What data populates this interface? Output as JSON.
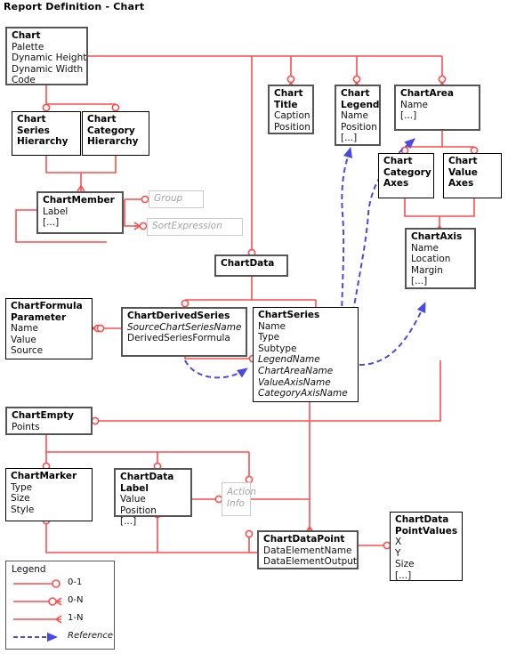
{
  "page": {
    "title": "Report Definition - Chart"
  },
  "colors": {
    "relationship": "#ff4d4d",
    "reference": "#4a4ae0",
    "box_border": "#000000",
    "box_border_thick": "#555555",
    "ghost_border": "#cccccc",
    "ghost_text": "#a6a6a6",
    "background": "#ffffff",
    "text": "#111111"
  },
  "entities": [
    {
      "id": "chart",
      "title": "Chart",
      "attributes": [
        "Palette",
        "Dynamic Height",
        "Dynamic Width",
        "Code"
      ],
      "style": "thick"
    },
    {
      "id": "chart-series-hierarchy",
      "title": "Chart Series Hierarchy",
      "title_lines": [
        "Chart",
        "Series",
        "Hierarchy"
      ],
      "attributes": [],
      "style": "normal"
    },
    {
      "id": "chart-category-hierarchy",
      "title": "Chart Category Hierarchy",
      "title_lines": [
        "Chart",
        "Category",
        "Hierarchy"
      ],
      "attributes": [],
      "style": "normal"
    },
    {
      "id": "chart-member",
      "title": "ChartMember",
      "attributes": [
        "Label",
        "[...]"
      ],
      "style": "thick"
    },
    {
      "id": "chart-title",
      "title": "Chart Title",
      "title_lines": [
        "Chart",
        "Title"
      ],
      "attributes": [
        "Caption",
        "Position"
      ],
      "style": "thick"
    },
    {
      "id": "chart-legend",
      "title": "Chart Legend",
      "title_lines": [
        "Chart",
        "Legend"
      ],
      "attributes": [
        "Name",
        "Position",
        "[...]"
      ],
      "style": "thick"
    },
    {
      "id": "chart-area",
      "title": "ChartArea",
      "attributes": [
        "Name",
        "[...]"
      ],
      "style": "thick"
    },
    {
      "id": "chart-category-axes",
      "title": "Chart Category Axes",
      "title_lines": [
        "Chart",
        "Category",
        "Axes"
      ],
      "attributes": [],
      "style": "normal"
    },
    {
      "id": "chart-value-axes",
      "title": "Chart Value Axes",
      "title_lines": [
        "Chart",
        "Value",
        "Axes"
      ],
      "attributes": [],
      "style": "normal"
    },
    {
      "id": "chart-axis",
      "title": "ChartAxis",
      "attributes": [
        "Name",
        "Location",
        "Margin",
        "[...]"
      ],
      "style": "thick"
    },
    {
      "id": "chart-data",
      "title": "ChartData",
      "attributes": [],
      "style": "thick"
    },
    {
      "id": "chart-formula-parameter",
      "title": "ChartFormula Parameter",
      "title_lines": [
        "ChartFormula",
        "Parameter"
      ],
      "attributes": [
        "Name",
        "Value",
        "Source"
      ],
      "style": "normal"
    },
    {
      "id": "chart-derived-series",
      "title": "ChartDerivedSeries",
      "attributes": [
        "SourceChartSeriesName",
        "DerivedSeriesFormula"
      ],
      "italic_attributes": [
        "SourceChartSeriesName"
      ],
      "style": "thick"
    },
    {
      "id": "chart-series",
      "title": "ChartSeries",
      "attributes": [
        "Name",
        "Type",
        "Subtype",
        "LegendName",
        "ChartAreaName",
        "ValueAxisName",
        "CategoryAxisName"
      ],
      "italic_attributes": [
        "LegendName",
        "ChartAreaName",
        "ValueAxisName",
        "CategoryAxisName"
      ],
      "style": "normal"
    },
    {
      "id": "chart-empty",
      "title": "ChartEmpty",
      "attributes": [
        "Points"
      ],
      "style": "thick"
    },
    {
      "id": "chart-marker",
      "title": "ChartMarker",
      "attributes": [
        "Type",
        "Size",
        "Style"
      ],
      "style": "normal"
    },
    {
      "id": "chart-data-label",
      "title": "ChartData Label",
      "title_lines": [
        "ChartData",
        "Label"
      ],
      "attributes": [
        "Value",
        "Position",
        "[...]"
      ],
      "style": "thick"
    },
    {
      "id": "chart-data-point",
      "title": "ChartDataPoint",
      "attributes": [
        "DataElementName",
        "DataElementOutput"
      ],
      "style": "thick"
    },
    {
      "id": "chart-data-point-values",
      "title": "ChartData PointValues",
      "title_lines": [
        "ChartData",
        "PointValues"
      ],
      "attributes": [
        "X",
        "Y",
        "Size",
        "[...]"
      ],
      "style": "normal"
    }
  ],
  "ghost_boxes": [
    {
      "id": "group",
      "label": "Group"
    },
    {
      "id": "sort-expression",
      "label": "SortExpression"
    },
    {
      "id": "action-info",
      "label": "Action Info",
      "lines": [
        "Action",
        "Info"
      ]
    }
  ],
  "legend": {
    "title": "Legend",
    "items": [
      {
        "id": "zero-one",
        "label": "0-1",
        "cardinality": "0-1"
      },
      {
        "id": "zero-n",
        "label": "0-N",
        "cardinality": "0-N"
      },
      {
        "id": "one-n",
        "label": "1-N",
        "cardinality": "1-N"
      },
      {
        "id": "reference",
        "label": "Reference",
        "cardinality": "reference"
      }
    ]
  }
}
